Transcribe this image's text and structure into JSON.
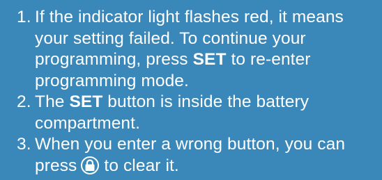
{
  "instructions": {
    "items": [
      {
        "number": "1.",
        "l1": "If the indicator light flashes red, it means",
        "l2": "your setting failed. To continue your",
        "l3_before": "programming, press ",
        "l3_bold": "SET",
        "l3_after": " to re-enter",
        "l4": "programming mode."
      },
      {
        "number": "2.",
        "l1_before": "The ",
        "l1_bold": "SET",
        "l1_after": " button is inside the battery",
        "l2": "compartment."
      },
      {
        "number": "3.",
        "l1": "When you enter a wrong button, you can",
        "l2_before": "press",
        "l2_icon": "lock-button-icon",
        "l2_after": "to clear it."
      }
    ]
  },
  "colors": {
    "background": "#3a87b9",
    "text": "#ffffff"
  }
}
